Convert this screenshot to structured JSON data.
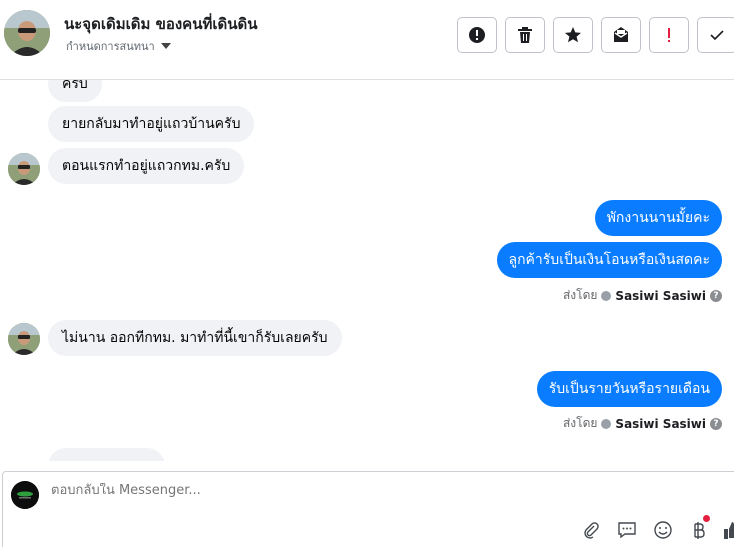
{
  "header": {
    "contact_name": "นะจุดเดิมเดิม ของคนที่เดินดิน",
    "conversation_settings": "กำหนดการสนทนา"
  },
  "toolbar": {
    "buttons": [
      {
        "name": "report-button",
        "icon": "exclamation-circle-icon"
      },
      {
        "name": "delete-button",
        "icon": "trash-icon"
      },
      {
        "name": "star-button",
        "icon": "star-icon"
      },
      {
        "name": "mark-unread-button",
        "icon": "envelope-icon"
      },
      {
        "name": "spam-button",
        "icon": "exclamation-icon"
      },
      {
        "name": "done-button",
        "icon": "check-icon"
      }
    ]
  },
  "messages": {
    "m1": "ครับ",
    "m2": "ยายกลับมาทำอยู่แถวบ้านครับ",
    "m3": "ตอนแรกทำอยู่แถวกทม.ครับ",
    "m4": "พักงานนานมั้ยคะ",
    "m5": "ลูกค้ารับเป็นเงินโอนหรือเงินสดคะ",
    "sent_by_label_1": "ส่งโดย",
    "sender_1": "Sasiwi Sasiwi",
    "m6": "ไม่นาน ออกทีกทม. มาทำที่นี้เขาก็รับเลยครับ",
    "m7": "รับเป็นรายวันหรือรายเดือน",
    "sent_by_label_2": "ส่งโดย",
    "sender_2": "Sasiwi Sasiwi",
    "help_mark": "?"
  },
  "composer": {
    "placeholder": "ตอบกลับใน Messenger..."
  },
  "colors": {
    "outgoing_bubble": "#0a7cff",
    "incoming_bubble": "#f0f2f5",
    "spam_red": "#e41e3f"
  }
}
